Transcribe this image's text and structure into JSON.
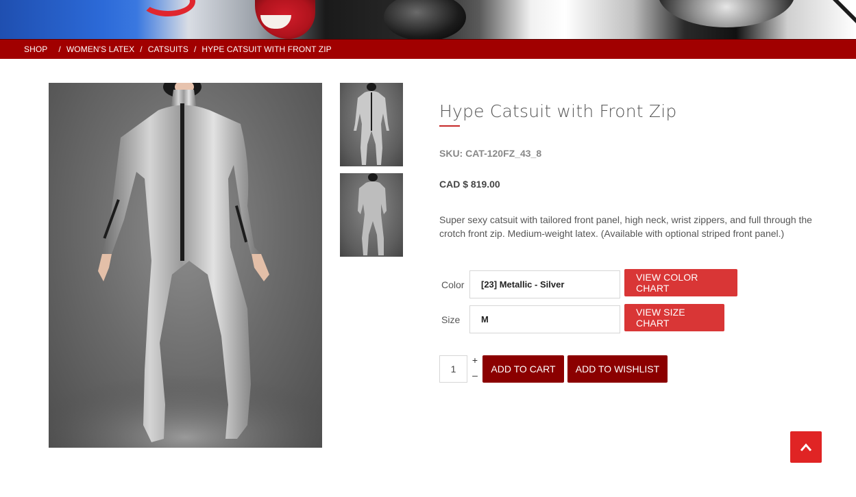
{
  "breadcrumb": {
    "items": [
      "SHOP",
      "WOMEN'S LATEX",
      "CATSUITS",
      "HYPE CATSUIT WITH FRONT ZIP"
    ],
    "separator": "/"
  },
  "product": {
    "title": "Hype Catsuit with Front Zip",
    "sku": "SKU: CAT-120FZ_43_8",
    "price": "CAD $ 819.00",
    "description": "Super sexy catsuit with tailored front panel, high neck, wrist zippers, and full through the crotch front zip. Medium-weight latex. (Available with optional striped front panel.)"
  },
  "options": {
    "color_label": "Color",
    "color_value": "[23] Metallic - Silver",
    "color_chart_button": "VIEW COLOR CHART",
    "size_label": "Size",
    "size_value": "M",
    "size_chart_button": "VIEW SIZE CHART"
  },
  "purchase": {
    "quantity": "1",
    "plus": "+",
    "minus": "–",
    "add_to_cart": "ADD TO CART",
    "add_to_wishlist": "ADD TO WISHLIST"
  },
  "colors": {
    "breadcrumb_bar": "#a10000",
    "chart_button": "#d93636",
    "cart_button": "#8b0000",
    "to_top_button": "#e02424",
    "title_rule": "#c62828"
  },
  "icons": {
    "to_top": "chevron-up-icon"
  }
}
